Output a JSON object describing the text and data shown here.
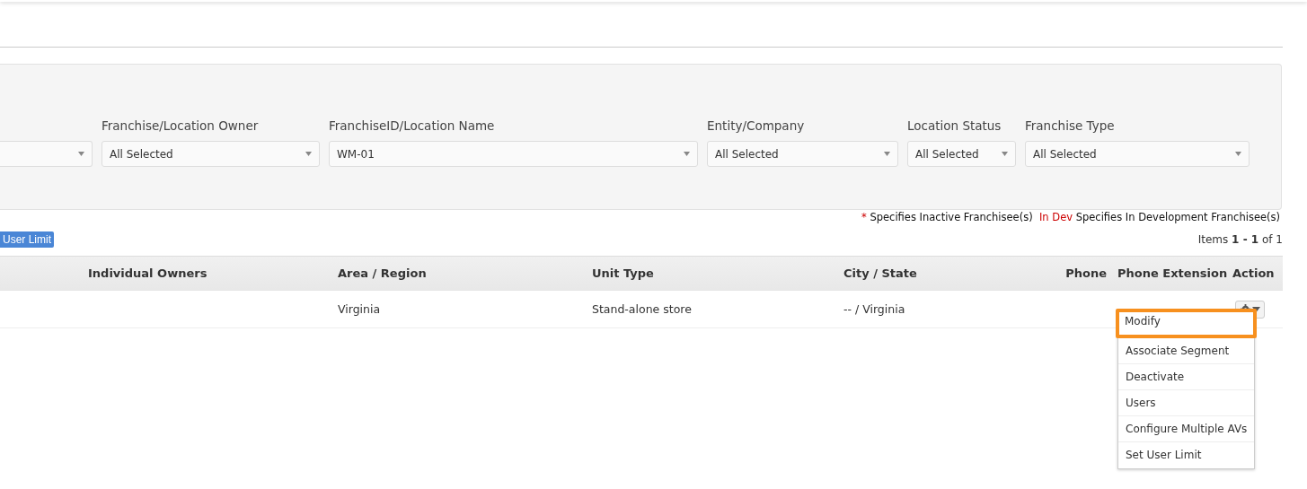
{
  "filters": [
    {
      "kind": "cut"
    },
    {
      "kind": "full",
      "label": "Franchise/Location Owner",
      "value": "All Selected"
    },
    {
      "kind": "full",
      "label": "FranchiseID/Location Name",
      "value": "WM-01"
    },
    {
      "kind": "full",
      "label": "Entity/Company",
      "value": "All Selected"
    },
    {
      "kind": "full",
      "label": "Location Status",
      "value": "All Selected"
    },
    {
      "kind": "full",
      "label": "Franchise Type",
      "value": "All Selected"
    }
  ],
  "legend": {
    "inactive_mark": "*",
    "inactive_text": "Specifies Inactive Franchisee(s)",
    "dev_mark": "In Dev",
    "dev_text": "Specifies In Development Franchisee(s)"
  },
  "user_limit_button": "User Limit",
  "items_count": "Items **1 - 1** of 1",
  "table": {
    "columns": [
      "Individual Owners",
      "Area / Region",
      "Unit Type",
      "City / State",
      "Phone",
      "Phone Extension",
      "Action"
    ],
    "rows": [
      {
        "cells": [
          "",
          "Virginia",
          "Stand-alone store",
          "-- / Virginia",
          "",
          ""
        ]
      }
    ]
  },
  "action_menu": [
    {
      "label": "Modify",
      "selected": true
    },
    {
      "label": "Associate Segment",
      "selected": false
    },
    {
      "label": "Deactivate",
      "selected": false
    },
    {
      "label": "Users",
      "selected": false
    },
    {
      "label": "Configure Multiple AVs",
      "selected": false
    },
    {
      "label": "Set User Limit",
      "selected": false
    }
  ]
}
